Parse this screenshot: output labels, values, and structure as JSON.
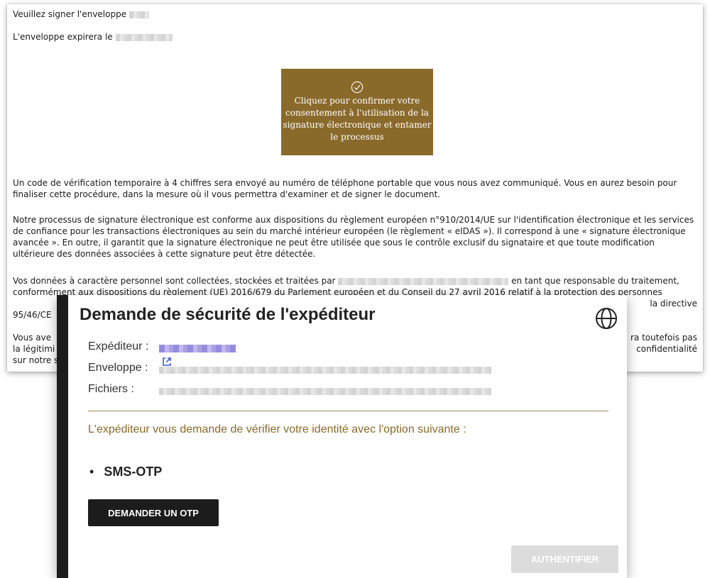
{
  "document": {
    "sign_prompt": "Veuillez signer l'enveloppe",
    "expiry_prefix": "L'enveloppe expirera le",
    "consent_button": "Cliquez pour confirmer votre consentement à l'utilisation de la signature électronique et entamer le processus",
    "paragraph_code": "Un code de vérification temporaire à 4 chiffres sera envoyé au numéro de téléphone portable que vous nous avez communiqué. Vous en aurez besoin pour finaliser cette procédure, dans la mesure où il vous permettra d'examiner et de signer le document.",
    "paragraph_eidas": "Notre processus de signature électronique est conforme aux dispositions du règlement européen n°910/2014/UE sur l'identification électronique et les services de confiance pour les transactions électroniques au sein du marché intérieur européen (le règlement « eIDAS »). Il correspond à une « signature électronique avancée ». En outre, il garantit que la signature électronique ne peut être utilisée que sous le contrôle exclusif du signataire et que toute modification ultérieure des données associées à cette signature peut être détectée.",
    "paragraph_data_1": "Vos données à caractère personnel sont collectées, stockées et traitées par",
    "paragraph_data_2": "en tant que responsable du traitement, conformément aux dispositions du règlement (UE) 2016/679 du Parlement européen et du Conseil du 27 avril 2016 relatif à la protection des personnes",
    "paragraph_data_3": "la directive",
    "paragraph_data_4": "95/46/CE",
    "paragraph_rights_1": "Vous ave",
    "paragraph_rights_right": "ra toutefois pas",
    "paragraph_rights_2": "la légitimi",
    "paragraph_rights_right2": "confidentialité",
    "paragraph_rights_3": "sur notre s"
  },
  "dialog": {
    "title": "Demande de sécurité de l'expéditeur",
    "sender_label": "Expéditeur :",
    "envelope_label": "Enveloppe :",
    "files_label": "Fichiers :",
    "identity_message": "L'expéditeur vous demande de vérifier votre identité avec l'option suivante :",
    "method_bullet": "•",
    "method": "SMS-OTP",
    "otp_button": "DEMANDER UN OTP",
    "auth_button": "AUTHENTIFIER"
  },
  "colors": {
    "accent_gold": "#8a6a2b",
    "dark": "#1c1c1c",
    "disabled": "#dcdcdc",
    "link_blue": "#3b5bdb"
  },
  "icons": [
    "check-circle-icon",
    "globe-icon",
    "external-link-icon"
  ]
}
